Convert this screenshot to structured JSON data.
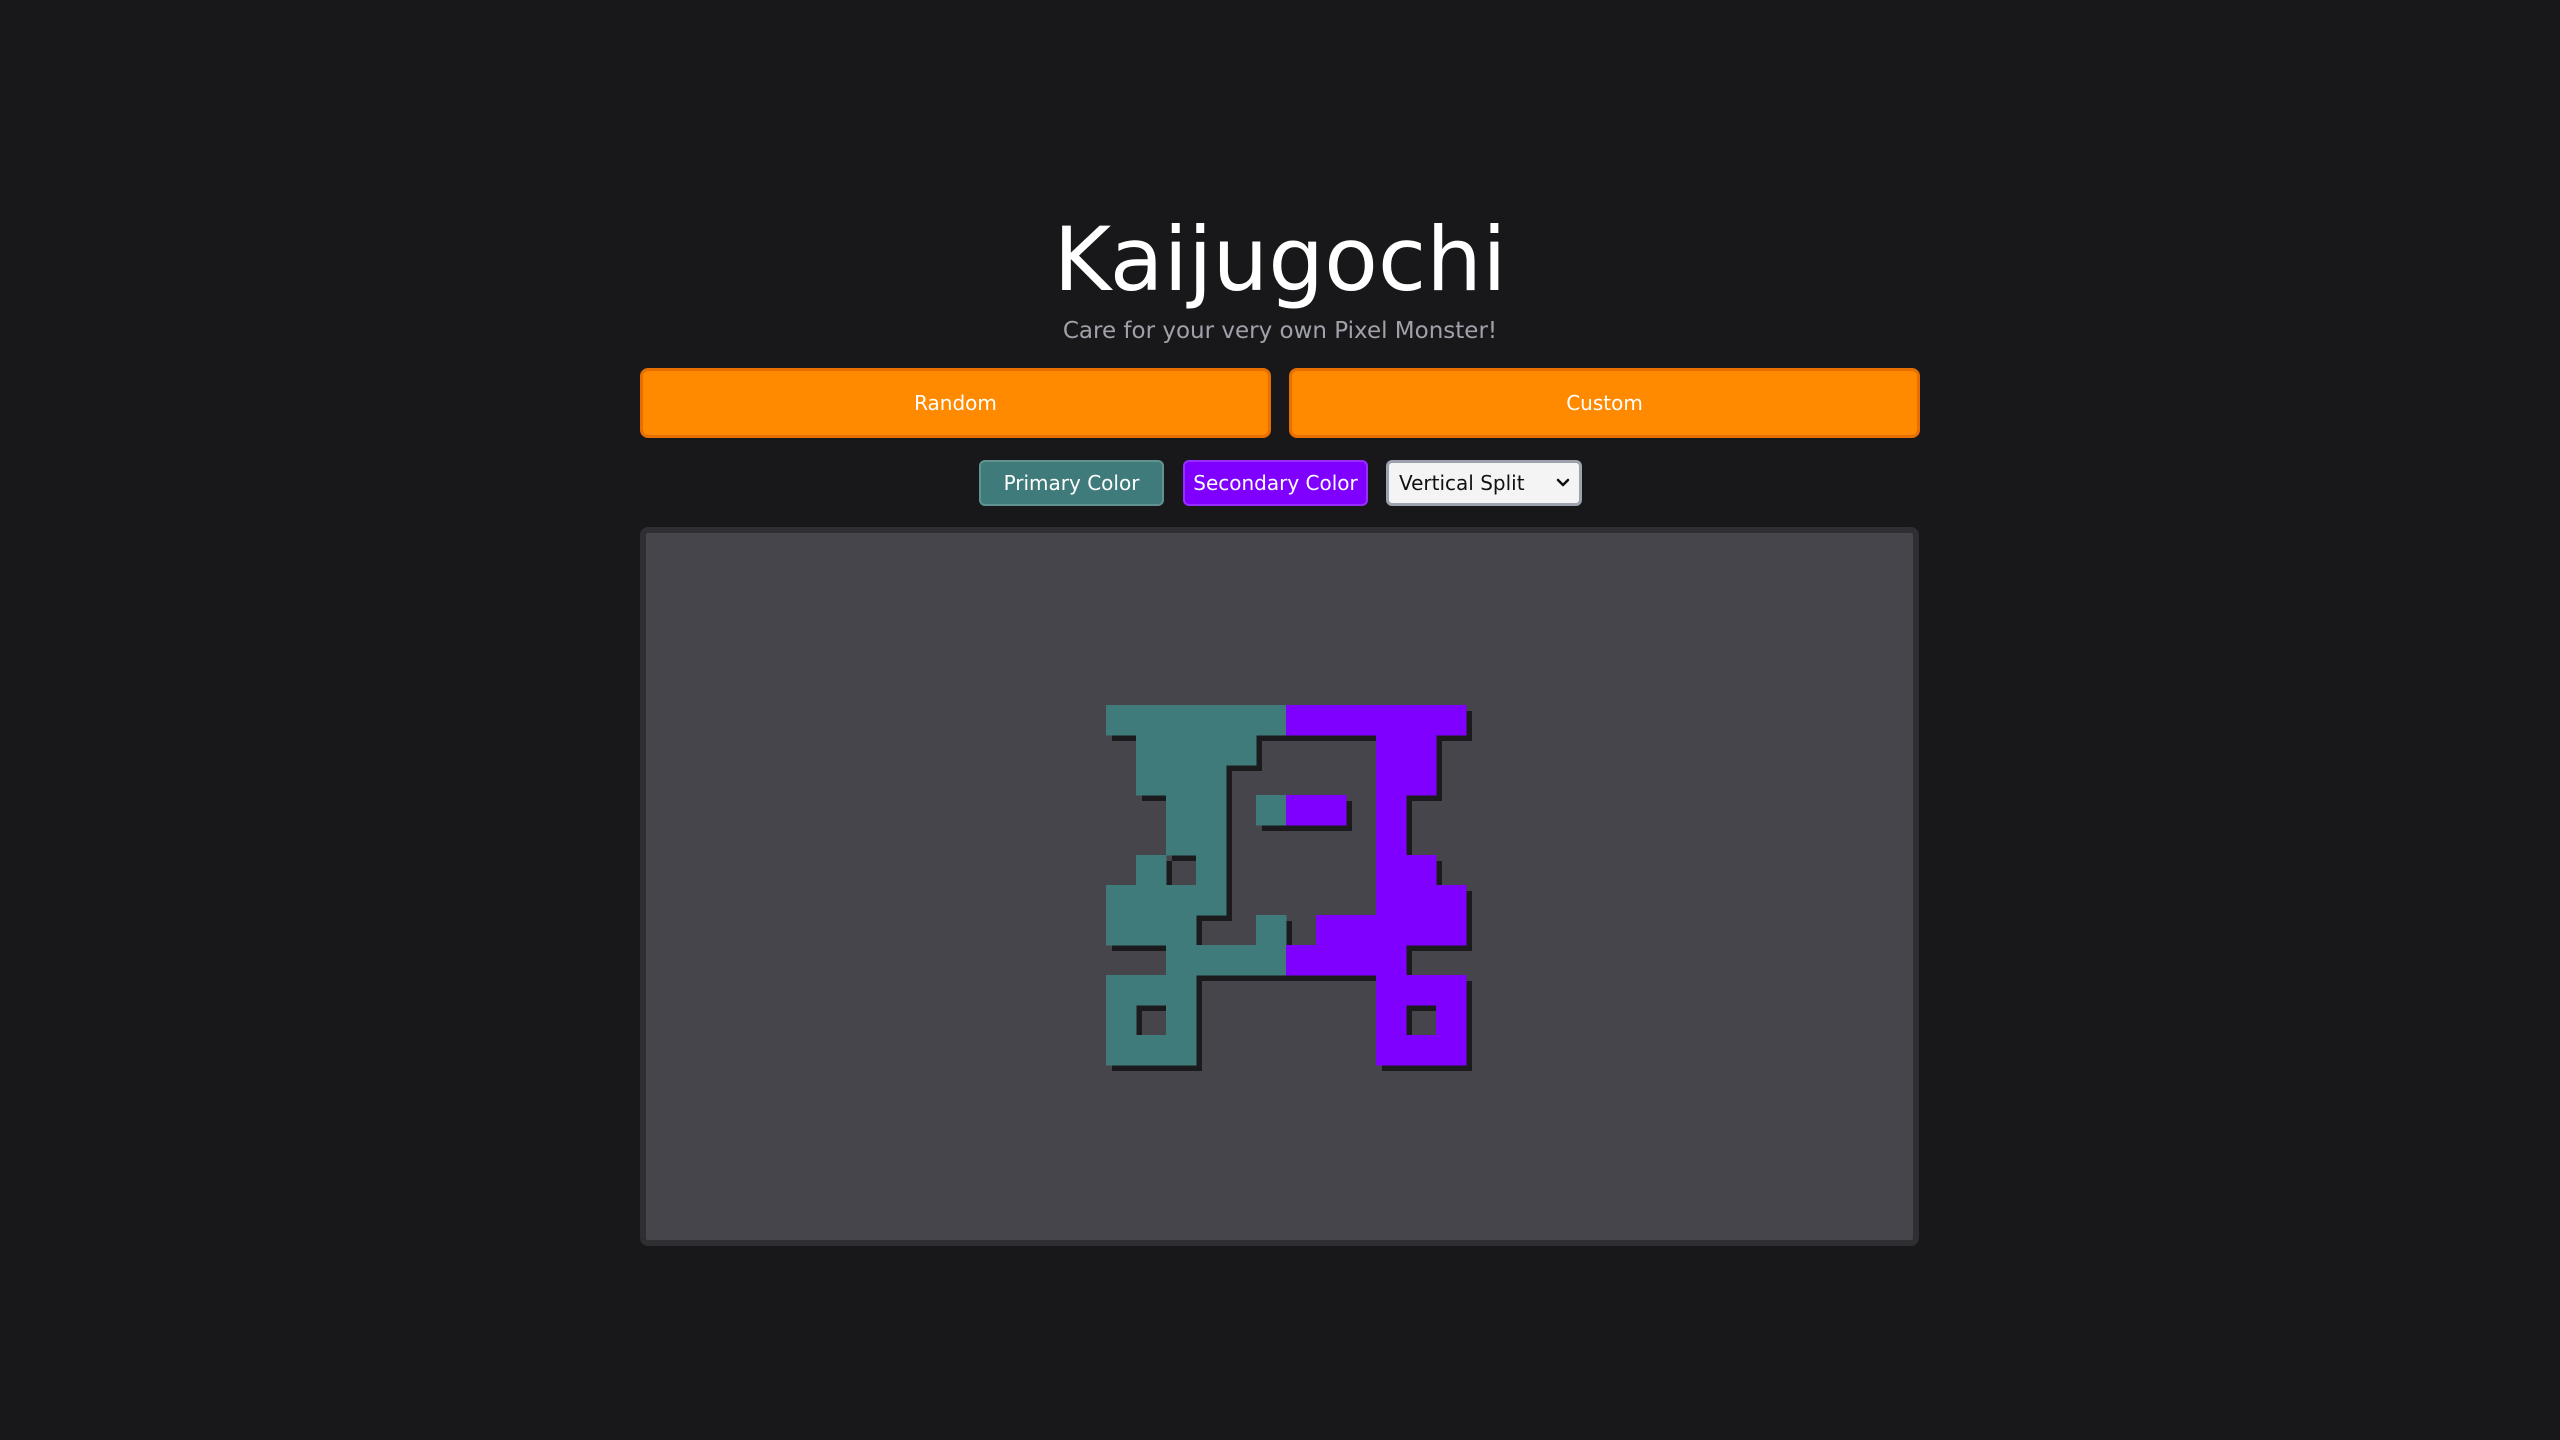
{
  "app": {
    "title": "Kaijugochi",
    "subtitle": "Care for your very own Pixel Monster!"
  },
  "modes": {
    "random_label": "Random",
    "custom_label": "Custom",
    "accent_color": "#ff8a00"
  },
  "controls": {
    "primary_label": "Primary Color",
    "primary_color": "#3f7b7a",
    "secondary_label": "Secondary Color",
    "secondary_color": "#8000ff",
    "split_selected": "Vertical Split"
  },
  "monster": {
    "grid_size": 12,
    "split": "vertical",
    "shadow_color": "#1b1b1e",
    "pixels": [
      "111111222222",
      "011110000220",
      "011100000220",
      "001101220200",
      "001100000200",
      "010100000220",
      "111100000222",
      "111001022222",
      "001111222200",
      "111000000222",
      "101000000202",
      "111000000222"
    ]
  }
}
